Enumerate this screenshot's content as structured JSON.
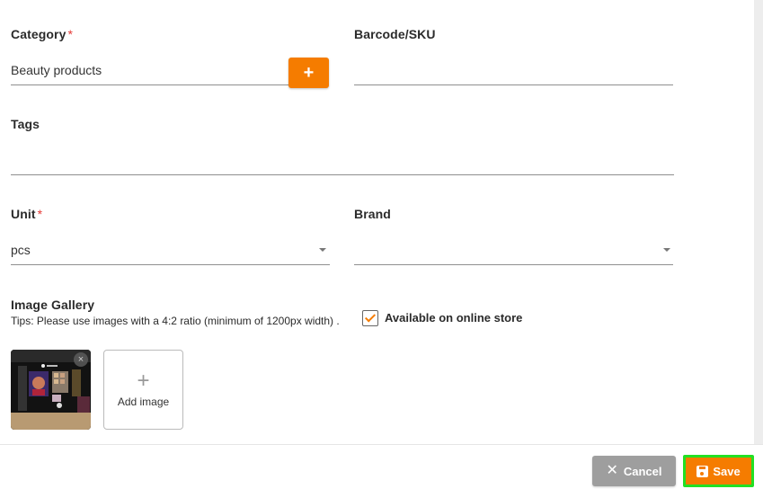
{
  "form": {
    "category": {
      "label": "Category",
      "required_mark": "*",
      "value": "Beauty products",
      "add_button": "+"
    },
    "barcode": {
      "label": "Barcode/SKU",
      "value": ""
    },
    "tags": {
      "label": "Tags",
      "value": ""
    },
    "unit": {
      "label": "Unit",
      "required_mark": "*",
      "value": "pcs"
    },
    "brand": {
      "label": "Brand",
      "value": ""
    },
    "gallery": {
      "label": "Image Gallery",
      "tips": "Tips: Please use images with a 4:2 ratio (minimum of 1200px width) .",
      "remove_icon": "×",
      "add_plus": "+",
      "add_label": "Add image"
    },
    "online_store": {
      "label": "Available on online store",
      "checked": true
    }
  },
  "footer": {
    "cancel_icon": "✕",
    "cancel_label": "Cancel",
    "save_label": "Save"
  },
  "colors": {
    "accent": "#f57c00",
    "focus_outline": "#22e022",
    "cancel_bg": "#9e9e9e",
    "required": "#e53935"
  }
}
